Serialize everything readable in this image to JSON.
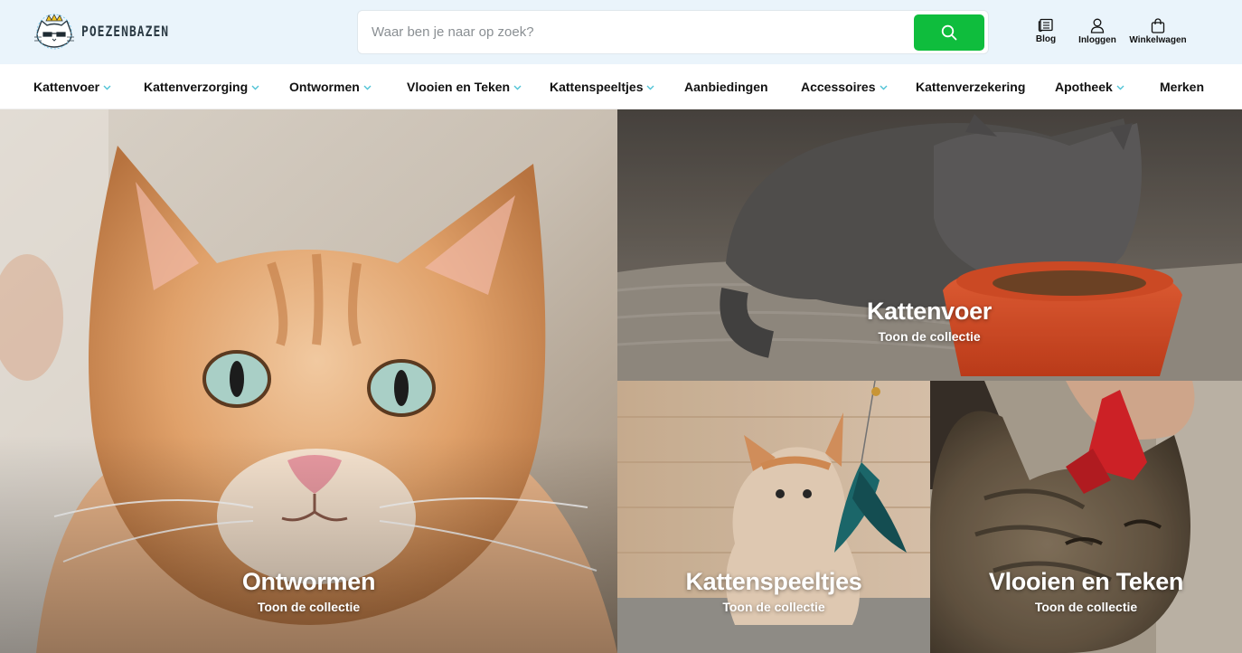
{
  "header": {
    "logo_text": "POEZENBAZEN",
    "search": {
      "placeholder": "Waar ben je naar op zoek?"
    },
    "links": [
      {
        "label": "Blog",
        "icon": "blog-icon"
      },
      {
        "label": "Inloggen",
        "icon": "user-icon"
      },
      {
        "label": "Winkelwagen",
        "icon": "bag-icon"
      }
    ]
  },
  "nav": {
    "items": [
      {
        "label": "Kattenvoer",
        "dropdown": true
      },
      {
        "label": "Kattenverzorging",
        "dropdown": true
      },
      {
        "label": "Ontwormen",
        "dropdown": true
      },
      {
        "label": "Vlooien en Teken",
        "dropdown": true
      },
      {
        "label": "Kattenspeeltjes",
        "dropdown": true
      },
      {
        "label": "Aanbiedingen",
        "dropdown": false
      },
      {
        "label": "Accessoires",
        "dropdown": true
      },
      {
        "label": "Kattenverzekering",
        "dropdown": false
      },
      {
        "label": "Apotheek",
        "dropdown": true
      },
      {
        "label": "Merken",
        "dropdown": false
      }
    ]
  },
  "hero": {
    "tiles": [
      {
        "title": "Ontwormen",
        "subtitle": "Toon de collectie"
      },
      {
        "title": "Kattenvoer",
        "subtitle": "Toon de collectie"
      },
      {
        "title": "Kattenspeeltjes",
        "subtitle": "Toon de collectie"
      },
      {
        "title": "Vlooien en Teken",
        "subtitle": "Toon de collectie"
      }
    ]
  },
  "colors": {
    "header_bg": "#eaf4fb",
    "search_button": "#0fbd3d",
    "chevron_accent": "#4fc3d6"
  }
}
